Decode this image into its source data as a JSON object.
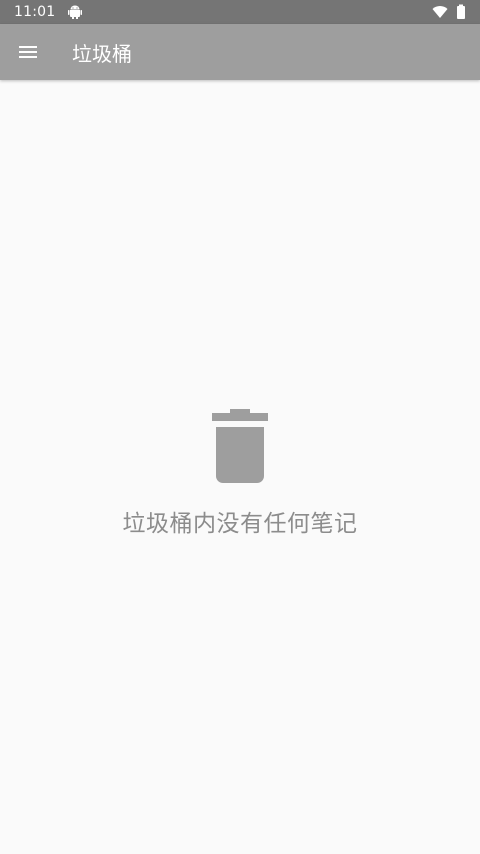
{
  "status_bar": {
    "time": "11:01",
    "icons": [
      "android-icon",
      "wifi-icon",
      "battery-icon"
    ]
  },
  "toolbar": {
    "menu_icon": "hamburger-menu-icon",
    "title": "垃圾桶"
  },
  "empty_state": {
    "icon": "trash-icon",
    "message": "垃圾桶内没有任何笔记"
  },
  "colors": {
    "status_bar_bg": "#757575",
    "toolbar_bg": "#9e9e9e",
    "page_bg": "#fafafa",
    "icon_gray": "#9e9e9e",
    "message_text": "#8c8c8c"
  }
}
